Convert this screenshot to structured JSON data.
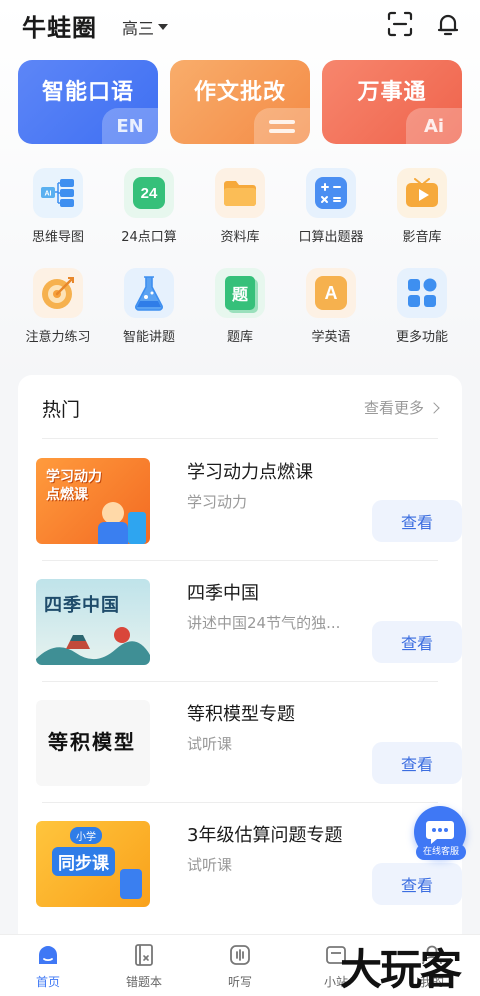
{
  "header": {
    "title": "牛蛙圈",
    "grade": "高三",
    "icons": [
      "scan-icon",
      "bell-icon"
    ]
  },
  "features": [
    {
      "label": "智能口语",
      "tag": "EN",
      "color": "#4a79f4"
    },
    {
      "label": "作文批改",
      "tag": "",
      "color": "#f59a55"
    },
    {
      "label": "万事通",
      "tag": "Ai",
      "color": "#f2735a"
    }
  ],
  "tools": [
    {
      "label": "思维导图",
      "icon": "mind-map-icon"
    },
    {
      "label": "24点口算",
      "icon": "twenty-four-icon",
      "glyph": "24"
    },
    {
      "label": "资料库",
      "icon": "folder-icon"
    },
    {
      "label": "口算出题器",
      "icon": "calculator-icon"
    },
    {
      "label": "影音库",
      "icon": "video-icon"
    },
    {
      "label": "注意力练习",
      "icon": "target-icon"
    },
    {
      "label": "智能讲题",
      "icon": "flask-icon"
    },
    {
      "label": "题库",
      "icon": "question-bank-icon",
      "glyph": "题"
    },
    {
      "label": "学英语",
      "icon": "english-icon",
      "glyph": "A"
    },
    {
      "label": "更多功能",
      "icon": "more-apps-icon"
    }
  ],
  "hot": {
    "title": "热门",
    "see_more": "查看更多",
    "courses": [
      {
        "title": "学习动力点燃课",
        "subtitle": "学习动力",
        "button": "查看",
        "thumb_text": "学习动力\n点燃课"
      },
      {
        "title": "四季中国",
        "subtitle": "讲述中国24节气的独...",
        "button": "查看",
        "thumb_text": "四季中国"
      },
      {
        "title": "等积模型专题",
        "subtitle": "试听课",
        "button": "查看",
        "thumb_text": "等积模型"
      },
      {
        "title": "3年级估算问题专题",
        "subtitle": "试听课",
        "button": "查看",
        "thumb_text": "同步课",
        "thumb_badge": "小学"
      }
    ]
  },
  "service": {
    "label": "在线客服"
  },
  "tabbar": [
    {
      "label": "首页",
      "icon": "home-icon",
      "active": true
    },
    {
      "label": "错题本",
      "icon": "wrong-book-icon",
      "active": false
    },
    {
      "label": "听写",
      "icon": "dictation-icon",
      "active": false
    },
    {
      "label": "小站",
      "icon": "station-icon",
      "active": false
    },
    {
      "label": "我的",
      "icon": "profile-icon",
      "active": false
    }
  ],
  "watermark": "大玩客"
}
